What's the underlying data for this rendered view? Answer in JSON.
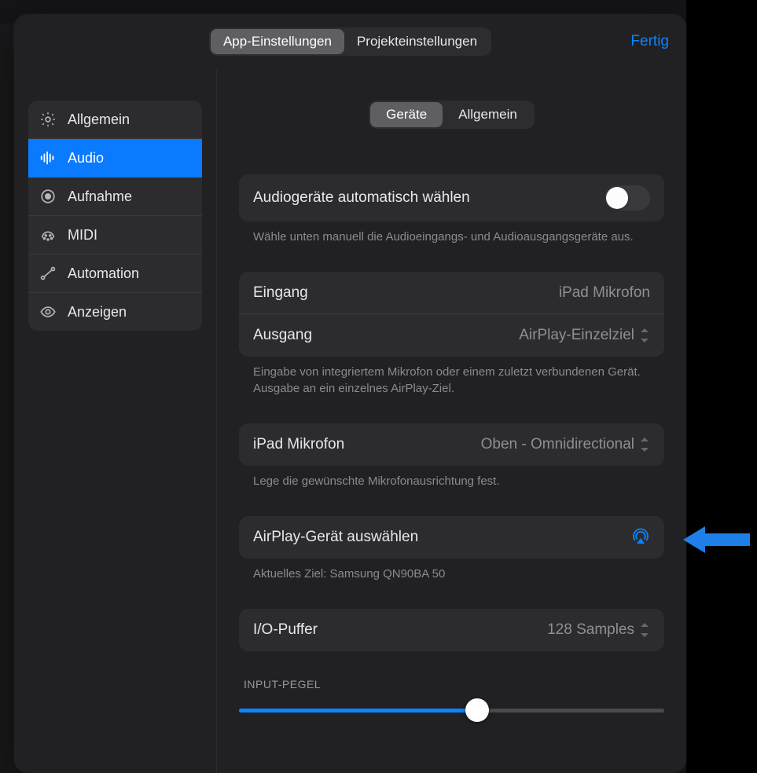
{
  "header": {
    "tabs": {
      "app": "App-Einstellungen",
      "project": "Projekteinstellungen"
    },
    "done": "Fertig"
  },
  "sidebar": {
    "items": [
      {
        "label": "Allgemein"
      },
      {
        "label": "Audio"
      },
      {
        "label": "Aufnahme"
      },
      {
        "label": "MIDI"
      },
      {
        "label": "Automation"
      },
      {
        "label": "Anzeigen"
      }
    ]
  },
  "sub_tabs": {
    "devices": "Geräte",
    "general": "Allgemein"
  },
  "auto_select": {
    "label": "Audiogeräte automatisch wählen",
    "note": "Wähle unten manuell die Audioeingangs- und Audioausgangsgeräte aus."
  },
  "io": {
    "input_label": "Eingang",
    "input_value": "iPad Mikrofon",
    "output_label": "Ausgang",
    "output_value": "AirPlay-Einzelziel",
    "note": "Eingabe von integriertem Mikrofon oder einem zuletzt verbundenen Gerät. Ausgabe an ein einzelnes AirPlay-Ziel."
  },
  "mic": {
    "label": "iPad Mikrofon",
    "value": "Oben - Omnidirectional",
    "note": "Lege die gewünschte Mikrofonausrichtung fest."
  },
  "airplay": {
    "label": "AirPlay-Gerät auswählen",
    "current": "Aktuelles Ziel: Samsung QN90BA 50"
  },
  "buffer": {
    "label": "I/O-Puffer",
    "value": "128 Samples"
  },
  "input_level": {
    "title": "INPUT-PEGEL"
  },
  "colors": {
    "accent": "#0a84ff"
  }
}
